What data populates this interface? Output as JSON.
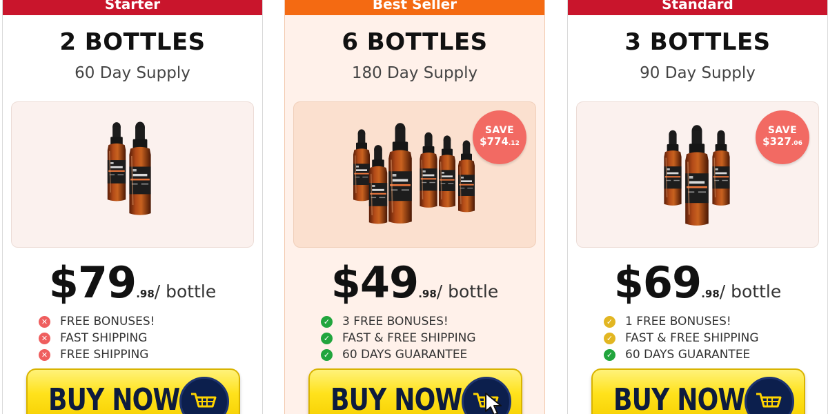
{
  "colors": {
    "starter_ribbon": "#c9152c",
    "best_seller_ribbon": "#f46a12",
    "standard_ribbon": "#c9152c",
    "x_icon": "#ef5e5e",
    "check_green": "#21a53d",
    "check_yellow": "#e2b622",
    "save_badge": "#f26a63",
    "buy_button": "#ffe21c",
    "cart_circle": "#0c1f4d"
  },
  "plans": [
    {
      "ribbon": "Starter",
      "title": "2 BOTTLES",
      "supply": "60 Day Supply",
      "save_label": "",
      "save_amount": "",
      "save_cents": "",
      "price_dollars": "$79",
      "price_cents": ".98",
      "price_unit": "/ bottle",
      "features": [
        {
          "icon": "x-icon",
          "text": "FREE BONUSES!"
        },
        {
          "icon": "x-icon",
          "text": "FAST SHIPPING"
        },
        {
          "icon": "x-icon",
          "text": "FREE SHIPPING"
        }
      ],
      "button_label": "BUY NOW",
      "button_icon": "cart-icon"
    },
    {
      "ribbon": "Best Seller",
      "title": "6 BOTTLES",
      "supply": "180 Day Supply",
      "save_label": "SAVE",
      "save_amount": "$774",
      "save_cents": ".12",
      "price_dollars": "$49",
      "price_cents": ".98",
      "price_unit": "/ bottle",
      "features": [
        {
          "icon": "check-icon",
          "text": "3 FREE BONUSES!"
        },
        {
          "icon": "check-icon",
          "text": "FAST & FREE SHIPPING"
        },
        {
          "icon": "check-icon",
          "text": "60 DAYS GUARANTEE"
        }
      ],
      "button_label": "BUY NOW",
      "button_icon": "cart-icon"
    },
    {
      "ribbon": "Standard",
      "title": "3 BOTTLES",
      "supply": "90 Day Supply",
      "save_label": "SAVE",
      "save_amount": "$327",
      "save_cents": ".06",
      "price_dollars": "$69",
      "price_cents": ".98",
      "price_unit": "/ bottle",
      "features": [
        {
          "icon": "check-icon",
          "text": "1 FREE BONUSES!"
        },
        {
          "icon": "check-icon",
          "text": "FAST & FREE SHIPPING"
        },
        {
          "icon": "check-icon",
          "text": "60 DAYS GUARANTEE"
        }
      ],
      "button_label": "BUY NOW",
      "button_icon": "cart-icon"
    }
  ]
}
